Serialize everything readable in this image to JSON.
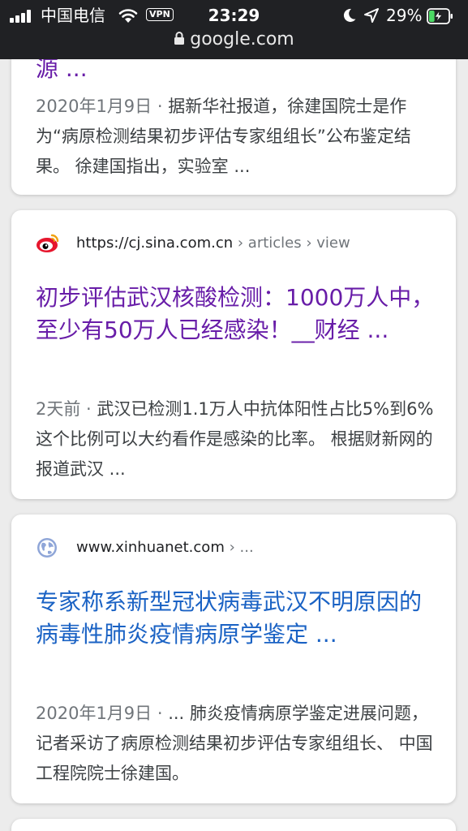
{
  "status_bar": {
    "carrier": "中国电信",
    "vpn": "VPN",
    "time": "23:29",
    "battery": "29%",
    "battery_level": 0.29,
    "url": "google.com"
  },
  "results": [
    {
      "title_tail": "源 ...",
      "date": "2020年1月9日 · ",
      "snippet": "据新华社报道，徐建国院士是作为“病原检测结果初步评估专家组组长”公布鉴定结果。 徐建国指出，实验室 ..."
    },
    {
      "url": "https://cj.sina.com.cn",
      "crumbs": " › articles › view",
      "favicon": "sina-weibo-eye-icon",
      "title": "初步评估武汉核酸检测：1000万人中，至少有50万人已经感染！__财经 ...",
      "date": "2天前 · ",
      "snippet": "武汉已检测1.1万人中抗体阳性占比5%到6%这个比例可以大约看作是感染的比率。 根据财新网的报道武汉 ..."
    },
    {
      "url": "www.xinhuanet.com",
      "crumbs": " › ...",
      "favicon": "globe-icon",
      "title": "专家称系新型冠状病毒武汉不明原因的病毒性肺炎疫情病原学鉴定 ...",
      "date": "2020年1月9日 · ",
      "snippet": "... 肺炎疫情病原学鉴定进展问题，记者采访了病原检测结果初步评估专家组组长、 中国工程院院士徐建国。"
    }
  ],
  "colors": {
    "visited_link": "#681da8",
    "link": "#1a62c4",
    "status_bar": "#202124",
    "battery_fill": "#4cd964"
  }
}
